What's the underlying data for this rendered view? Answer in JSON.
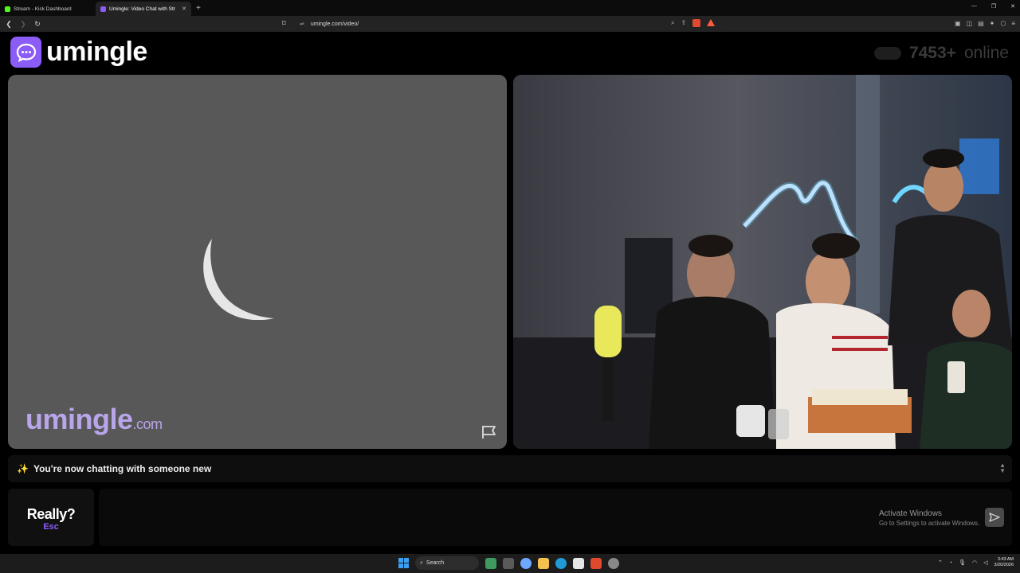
{
  "browser": {
    "tabs": [
      {
        "title": "Stream - Kick Dashboard",
        "favicon_color": "#53fc18",
        "active": false
      },
      {
        "title": "Umingle: Video Chat with Str",
        "favicon_color": "#8b5cf6",
        "active": true
      }
    ],
    "new_tab": "+",
    "url": "umingle.com/video/"
  },
  "header": {
    "logo_text": "umingle",
    "online_count": "7453+",
    "online_label": "online"
  },
  "video_left": {
    "watermark_main": "umingle",
    "watermark_tld": ".com"
  },
  "status": {
    "message": "You're now chatting with someone new"
  },
  "controls": {
    "skip_label": "Really?",
    "skip_hint": "Esc",
    "chat_value": ""
  },
  "windows": {
    "activate_title": "Activate Windows",
    "activate_sub": "Go to Settings to activate Windows.",
    "search_label": "Search",
    "time": "3:43 AM",
    "date": "3/20/2026"
  },
  "colors": {
    "accent": "#8b5cf6",
    "watermark": "#b9a5ea",
    "video_placeholder": "#585858"
  },
  "icons": [
    "chat-bubble-icon",
    "flag-icon",
    "send-icon",
    "spinner-icon",
    "windows-start-icon",
    "search-icon"
  ]
}
